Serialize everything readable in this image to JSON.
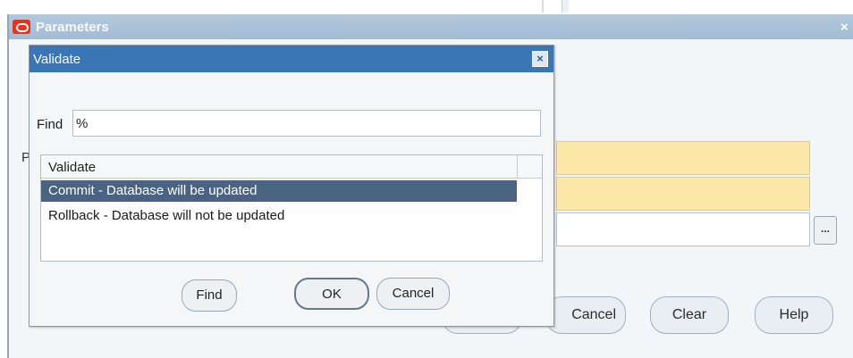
{
  "parameters_window": {
    "title": "Parameters",
    "close_glyph": "×",
    "label_stub": "P",
    "lov_glyph": "...",
    "buttons": {
      "hidden": "",
      "cancel": "Cancel",
      "clear": "Clear",
      "help": "Help"
    }
  },
  "validate_dialog": {
    "title": "Validate",
    "close_glyph": "×",
    "find_label": "Find",
    "find_value": "%",
    "list_header": "Validate",
    "rows": [
      {
        "label": "Commit - Database will be updated",
        "selected": true
      },
      {
        "label": "Rollback - Database will not be updated",
        "selected": false
      }
    ],
    "buttons": {
      "find": "Find",
      "ok": "OK",
      "cancel": "Cancel"
    }
  },
  "colors": {
    "selection": "#4a6383",
    "title_bar_active": "#3a75b5",
    "title_bar_inactive": "#a3bcd4",
    "required_field": "#fbe8a8",
    "oracle_red": "#e8321e"
  }
}
